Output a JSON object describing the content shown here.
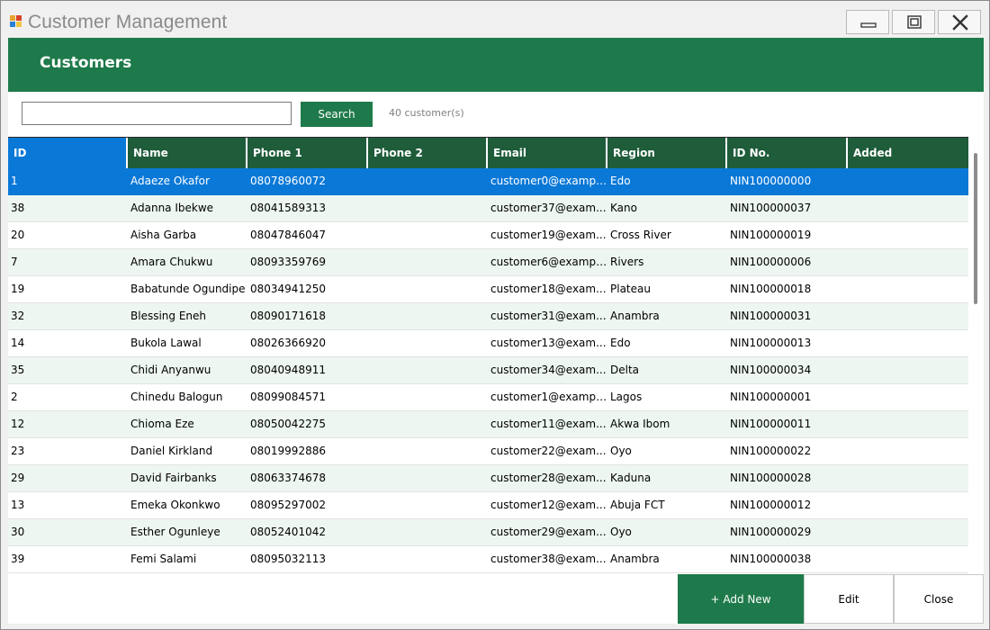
{
  "window": {
    "title": "Customer Management"
  },
  "header": {
    "title": "Customers"
  },
  "search": {
    "value": "",
    "placeholder": "",
    "button_label": "Search",
    "count_label": "40 customer(s)"
  },
  "grid": {
    "columns": [
      "ID",
      "Name",
      "Phone 1",
      "Phone 2",
      "Email",
      "Region",
      "ID No.",
      "Added"
    ],
    "rows": [
      [
        "1",
        "Adaeze Okafor",
        "08078960072",
        "",
        "customer0@exampl...",
        "Edo",
        "NIN100000000",
        ""
      ],
      [
        "38",
        "Adanna Ibekwe",
        "08041589313",
        "",
        "customer37@exam...",
        "Kano",
        "NIN100000037",
        ""
      ],
      [
        "20",
        "Aisha Garba",
        "08047846047",
        "",
        "customer19@exam...",
        "Cross River",
        "NIN100000019",
        ""
      ],
      [
        "7",
        "Amara Chukwu",
        "08093359769",
        "",
        "customer6@exampl...",
        "Rivers",
        "NIN100000006",
        ""
      ],
      [
        "19",
        "Babatunde Ogundipe",
        "08034941250",
        "",
        "customer18@exam...",
        "Plateau",
        "NIN100000018",
        ""
      ],
      [
        "32",
        "Blessing Eneh",
        "08090171618",
        "",
        "customer31@exam...",
        "Anambra",
        "NIN100000031",
        ""
      ],
      [
        "14",
        "Bukola Lawal",
        "08026366920",
        "",
        "customer13@exam...",
        "Edo",
        "NIN100000013",
        ""
      ],
      [
        "35",
        "Chidi Anyanwu",
        "08040948911",
        "",
        "customer34@exam...",
        "Delta",
        "NIN100000034",
        ""
      ],
      [
        "2",
        "Chinedu Balogun",
        "08099084571",
        "",
        "customer1@exampl...",
        "Lagos",
        "NIN100000001",
        ""
      ],
      [
        "12",
        "Chioma Eze",
        "08050042275",
        "",
        "customer11@exam...",
        "Akwa Ibom",
        "NIN100000011",
        ""
      ],
      [
        "23",
        "Daniel Kirkland",
        "08019992886",
        "",
        "customer22@exam...",
        "Oyo",
        "NIN100000022",
        ""
      ],
      [
        "29",
        "David Fairbanks",
        "08063374678",
        "",
        "customer28@exam...",
        "Kaduna",
        "NIN100000028",
        ""
      ],
      [
        "13",
        "Emeka Okonkwo",
        "08095297002",
        "",
        "customer12@exam...",
        "Abuja FCT",
        "NIN100000012",
        ""
      ],
      [
        "30",
        "Esther Ogunleye",
        "08052401042",
        "",
        "customer29@exam...",
        "Oyo",
        "NIN100000029",
        ""
      ],
      [
        "39",
        "Femi Salami",
        "08095032113",
        "",
        "customer38@exam...",
        "Anambra",
        "NIN100000038",
        ""
      ]
    ]
  },
  "actions": {
    "add_label": "+ Add New",
    "edit_label": "Edit",
    "close_label": "Close"
  },
  "colors": {
    "brand_green": "#1e7a4a",
    "header_dark_green": "#1e5c3a",
    "selection_blue": "#0a78d7",
    "alt_row": "#edf6f0"
  }
}
